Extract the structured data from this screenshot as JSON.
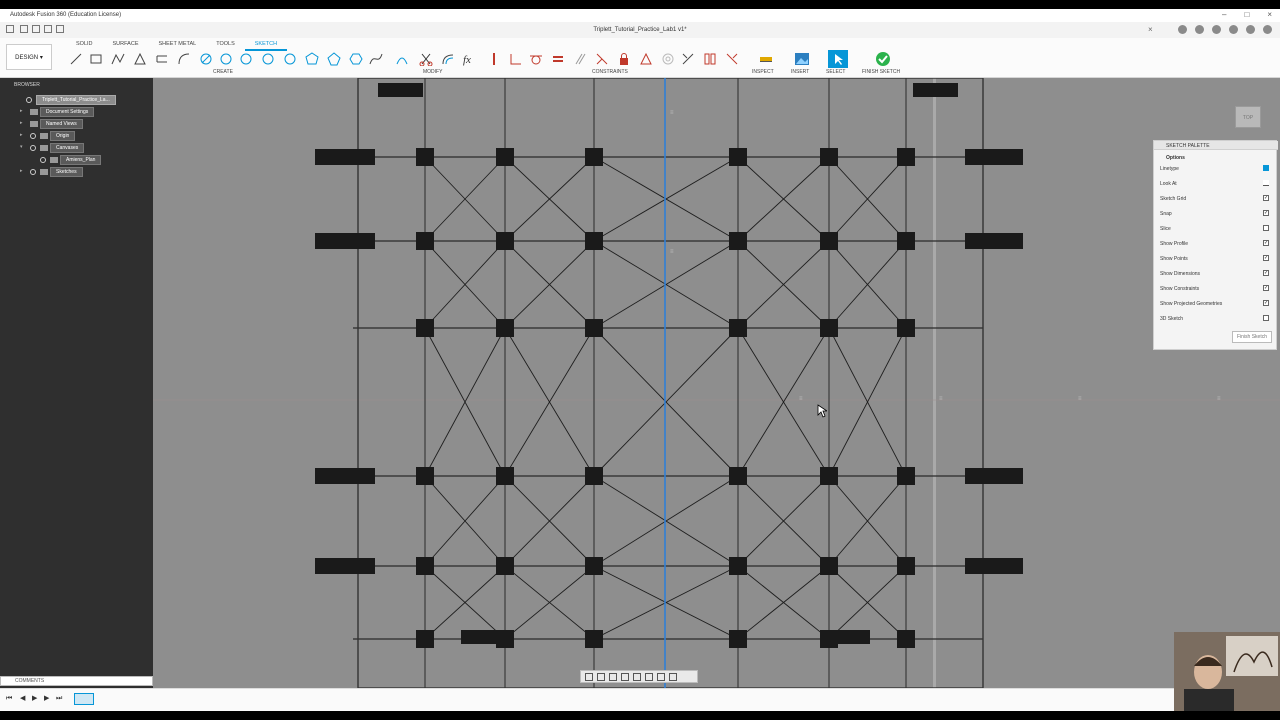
{
  "window": {
    "title": "Autodesk Fusion 360 (Education License)",
    "document_tab": "Triplett_Tutorial_Practice_Lab1 v1*"
  },
  "toolbar": {
    "workspace": "DESIGN",
    "tabs": [
      "SOLID",
      "SURFACE",
      "SHEET METAL",
      "TOOLS",
      "SKETCH"
    ],
    "groups": {
      "create": "CREATE",
      "modify": "MODIFY",
      "constraints": "CONSTRAINTS",
      "inspect": "INSPECT",
      "insert": "INSERT",
      "select": "SELECT",
      "finish": "FINISH SKETCH"
    }
  },
  "browser": {
    "header": "BROWSER",
    "items": [
      "Triplett_Tutorial_Practice_La...",
      "Document Settings",
      "Named Views",
      "Origin",
      "Canvases",
      "Amiens_Plan",
      "Sketches"
    ],
    "comments": "COMMENTS"
  },
  "viewcube": {
    "label": "TOP"
  },
  "palette": {
    "title": "SKETCH PALETTE",
    "section": "Options",
    "rows": [
      "Linetype",
      "Look At",
      "Sketch Grid",
      "Snap",
      "Slice",
      "Show Profile",
      "Show Points",
      "Show Dimensions",
      "Show Constraints",
      "Show Projected Geometries",
      "3D Sketch"
    ],
    "checked": [
      null,
      null,
      true,
      true,
      false,
      true,
      true,
      true,
      true,
      true,
      false
    ],
    "finish_button": "Finish Sketch"
  },
  "colors": {
    "accent": "#0696d7",
    "finish_green": "#2bb24c",
    "canvas": "#8e8e8e",
    "axis_line": "#2f7fd6"
  }
}
